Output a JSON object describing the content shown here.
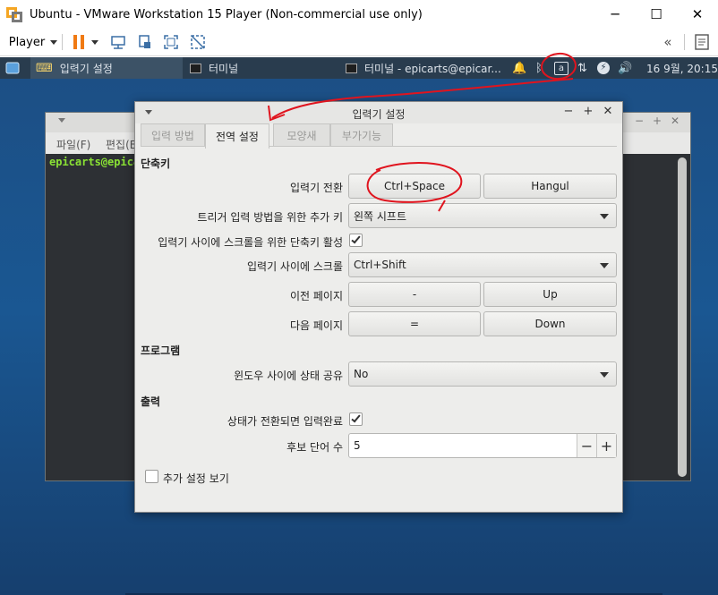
{
  "host": {
    "title": "Ubuntu - VMware Workstation 15 Player (Non-commercial use only)",
    "player_menu": "Player",
    "minimize": "─",
    "maximize": "☐",
    "close": "✕",
    "forward_icon": "«"
  },
  "panel": {
    "active_app": "입력기 설정",
    "task_terminal": "터미널",
    "task_terminal2": "터미널 - epicarts@epicar...",
    "clock": "16 9월, 20:15",
    "tray_input_indicator": "a"
  },
  "terminal": {
    "menu_file": "파일(F)",
    "menu_edit": "편집(E",
    "prompt": "epicarts@epica"
  },
  "dialog": {
    "title": "입력기 설정",
    "tabs": [
      "입력 방법",
      "전역 설정",
      "모양새",
      "부가기능"
    ],
    "section_hotkeys": "단축키",
    "row_switch_label": "입력기 전환",
    "row_switch_btn1": "Ctrl+Space",
    "row_switch_btn2": "Hangul",
    "row_trigger_label": "트리거 입력 방법을 위한 추가 키",
    "row_trigger_value": "왼쪽 시프트",
    "row_scroll_hotkey_label": "입력기 사이에 스크롤을 위한 단축키 활성",
    "row_scroll_label": "입력기 사이에 스크롤",
    "row_scroll_value": "Ctrl+Shift",
    "row_prev_label": "이전 페이지",
    "row_prev_btn1": "-",
    "row_prev_btn2": "Up",
    "row_next_label": "다음 페이지",
    "row_next_btn1": "=",
    "row_next_btn2": "Down",
    "section_program": "프로그램",
    "row_share_label": "윈도우 사이에 상태 공유",
    "row_share_value": "No",
    "section_output": "출력",
    "row_commit_label": "상태가 전환되면 입력완료",
    "row_candidates_label": "후보 단어 수",
    "row_candidates_value": "5",
    "minus": "−",
    "plus": "+",
    "show_advanced": "추가 설정 보기"
  },
  "colors": {
    "panel_bg": "#293c4e",
    "desktop": "#1a5792",
    "annotation": "#e0141e",
    "terminal_prompt": "#8ae234"
  }
}
